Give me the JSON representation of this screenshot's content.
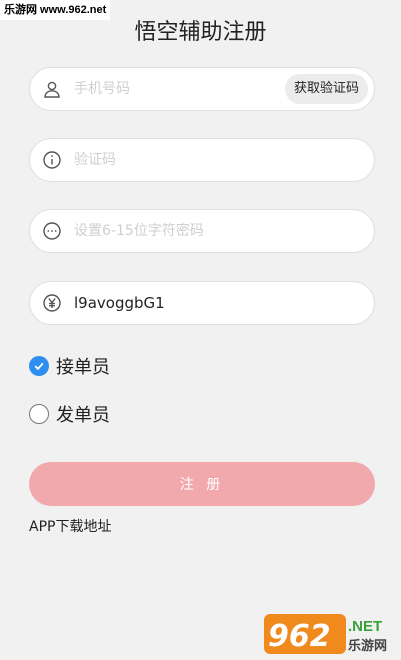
{
  "watermark_top": "乐游网 www.962.net",
  "title": "悟空辅助注册",
  "phone": {
    "placeholder": "手机号码",
    "value": "",
    "icon": "user-icon"
  },
  "get_code_button": "获取验证码",
  "verify": {
    "placeholder": "验证码",
    "value": "",
    "icon": "info-icon"
  },
  "password": {
    "placeholder": "设置6-15位字符密码",
    "value": "",
    "icon": "more-dots-icon"
  },
  "invite": {
    "placeholder": "",
    "value": "l9avoggbG1",
    "icon": "yuan-icon"
  },
  "roles": [
    {
      "label": "接单员",
      "checked": true
    },
    {
      "label": "发单员",
      "checked": false
    }
  ],
  "register_button": "注 册",
  "download_link": "APP下载地址",
  "watermark_logo": {
    "number": "962",
    "suffix": ".NET",
    "brand": "乐游网"
  },
  "colors": {
    "background": "#f1f1f1",
    "accent_blue": "#2f8ff0",
    "register_button": "#f2a9ae",
    "logo_orange": "#f08a1c",
    "logo_green": "#3aa03a"
  }
}
